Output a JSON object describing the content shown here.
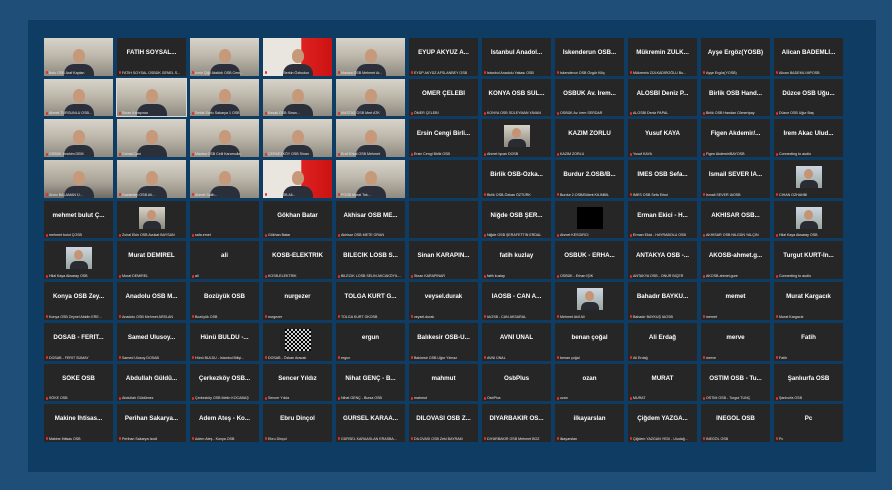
{
  "meeting": {
    "tiles": [
      {
        "kind": "video",
        "name": "",
        "caption": "Bolu OSB Araf Kaplan"
      },
      {
        "kind": "name",
        "name": "FATİH SOYSAL...",
        "caption": "FATİH SOYSAL OSBÜK GENEL S..."
      },
      {
        "kind": "video",
        "name": "",
        "caption": "İzmir Çiğli Atatürk OSB Cem..."
      },
      {
        "kind": "video",
        "variant": "flag",
        "name": "",
        "caption": "MOSTIM Berkin Özbudun"
      },
      {
        "kind": "video",
        "name": "",
        "caption": "Manisa OSB Mehmet Ar..."
      },
      {
        "kind": "name",
        "name": "EYÜP AKYÜZ A...",
        "caption": "EYÜP AKYÜZ AFSLANBEY OSB"
      },
      {
        "kind": "name",
        "name": "İstanbul Anadol...",
        "caption": "İstanbul Anadolu Yakası OSB"
      },
      {
        "kind": "name",
        "name": "İskenderun OSB...",
        "caption": "İskenderun OSB Özgür Kiliç"
      },
      {
        "kind": "name",
        "name": "Mükremin ZÜLK...",
        "caption": "Mükremin ZÜLKADİROĞLU Bu..."
      },
      {
        "kind": "name",
        "name": "Ayşe Ergöz(YOSB)",
        "caption": "Ayşe Ergöz(YOSB)"
      },
      {
        "kind": "name",
        "name": "Alican BADEMLİ...",
        "caption": "Alican BADEMLİ MPOSB"
      },
      {
        "kind": "video",
        "name": "",
        "caption": "Ahmet TURGUNLU OSB..."
      },
      {
        "kind": "video",
        "active": true,
        "name": "",
        "caption": "Sinan Karapınar"
      },
      {
        "kind": "video",
        "name": "",
        "caption": "Sedat Sarkı Sakarya 1 OSB"
      },
      {
        "kind": "video",
        "name": "",
        "caption": "Kavak OSB Sinan..."
      },
      {
        "kind": "video",
        "name": "",
        "caption": "MASTAŞ OSB Mert ATK"
      },
      {
        "kind": "name",
        "name": "ÖMER ÇELEBİ",
        "caption": "ÖMER ÇELEBİ"
      },
      {
        "kind": "name",
        "name": "KONYA OSB SÜL...",
        "caption": "KONYA OSB SÜLEYMAN YAVAN"
      },
      {
        "kind": "name",
        "name": "OSBÜK Av. İrem...",
        "caption": "OSBÜK Av. İrem SERDAR"
      },
      {
        "kind": "name",
        "name": "ALOSBİ Deniz P...",
        "caption": "ALOSBİ Deniz PAPAL"
      },
      {
        "kind": "name",
        "name": "Birlik OSB Hand...",
        "caption": "Birlik OSB Handan Cömertpay"
      },
      {
        "kind": "name",
        "name": "Düzce OSB Uğu...",
        "caption": "Düzce OSB Uğur Baş"
      },
      {
        "kind": "video",
        "name": "",
        "caption": "OSBÜK İbrahim DEM"
      },
      {
        "kind": "video",
        "name": "",
        "caption": "Cemal Cam"
      },
      {
        "kind": "video",
        "name": "",
        "caption": "Manisa OSB Celil Karamolla"
      },
      {
        "kind": "video",
        "name": "",
        "caption": "ÇERKEZKÖY OSB Sinan"
      },
      {
        "kind": "video",
        "name": "",
        "caption": "Ercif Erkal OSB Mehmet"
      },
      {
        "kind": "name",
        "name": "Ersin Cengi Birli...",
        "caption": "Ersin Cengi Birlik OSB"
      },
      {
        "kind": "avatar",
        "name": "",
        "caption": "Ahmet İşcan DOSB"
      },
      {
        "kind": "name",
        "name": "KAZIM ZORLU",
        "caption": "KAZIM ZORLU"
      },
      {
        "kind": "name",
        "name": "Yusuf KAYA",
        "caption": "Yusuf KAYA"
      },
      {
        "kind": "name",
        "name": "Figen Akdemir/...",
        "caption": "Figen Akdemir/BAYOSB"
      },
      {
        "kind": "name",
        "name": "İrem Akac Ulud...",
        "caption": "Connecting to audio"
      },
      {
        "kind": "video",
        "variant": "dark",
        "name": "",
        "caption": "Alsim BALAMAN Ü..."
      },
      {
        "kind": "video",
        "name": "",
        "caption": "Gaziantep OSB Ali..."
      },
      {
        "kind": "video",
        "name": "",
        "caption": "Ahmet Salih..."
      },
      {
        "kind": "video",
        "variant": "flag",
        "name": "",
        "caption": "Mardin OSB Ali..."
      },
      {
        "kind": "video",
        "name": "",
        "caption": "POSB Murat Tok..."
      },
      {
        "kind": "empty",
        "name": "",
        "caption": ""
      },
      {
        "kind": "name",
        "name": "Birlik OSB-Özka...",
        "caption": "Birlik OSB-Özkan ÖZTÜRK"
      },
      {
        "kind": "name",
        "name": "Burdur 2.OSB/B...",
        "caption": "Burdur 2.OSB/Bülent KILINBİL"
      },
      {
        "kind": "name",
        "name": "İMES OSB Sefa...",
        "caption": "İMES OSB Sefa Erkul"
      },
      {
        "kind": "name",
        "name": "İsmail SEVER İA...",
        "caption": "İsmail SEVER İAOSB"
      },
      {
        "kind": "avatar",
        "variant": "photo",
        "name": "",
        "caption": "CİHAN OZHANBİ"
      },
      {
        "kind": "name",
        "name": "mehmet bulut Ç...",
        "caption": "mehmet bulut ÇOSB"
      },
      {
        "kind": "avatar",
        "name": "",
        "caption": "Zuhal Ekin OSB Avukat BAYSAN"
      },
      {
        "kind": "empty",
        "name": "",
        "caption": "safa.emet"
      },
      {
        "kind": "name",
        "name": "Gökhan Batar",
        "caption": "Gökhan Batar"
      },
      {
        "kind": "name",
        "name": "Akhisar OSB ME...",
        "caption": "Akhisar OSB METE ORAN"
      },
      {
        "kind": "empty",
        "name": "",
        "caption": ""
      },
      {
        "kind": "name",
        "name": "Niğde OSB ŞER...",
        "caption": "Niğde OSB ŞERAFETTİN ERDAL"
      },
      {
        "kind": "avatar",
        "variant": "black",
        "name": "",
        "caption": "Ahmet KESGİRCİ"
      },
      {
        "kind": "name",
        "name": "Erman Ekici - H...",
        "caption": "Erman Ekici - HAYRABOLU OSB"
      },
      {
        "kind": "name",
        "name": "AKHİSAR OSB...",
        "caption": "AKHİSAR OSB NİLGÜN YALÇIN"
      },
      {
        "kind": "avatar",
        "variant": "photo",
        "name": "",
        "caption": "Hilal Kaya Aksaray OSB"
      },
      {
        "kind": "avatar",
        "variant": "photo",
        "name": "",
        "caption": "Hilal Kaya Aksaray OSB"
      },
      {
        "kind": "name",
        "name": "Murat DEMİREL",
        "caption": "Murat DEMİREL"
      },
      {
        "kind": "name",
        "name": "ali",
        "caption": "ali"
      },
      {
        "kind": "name",
        "name": "KOSB-ELEKTRİK",
        "caption": "KOSB-ELEKTRİK"
      },
      {
        "kind": "name",
        "name": "BİLECİK LOSB S...",
        "caption": "BİLECİK LOSB SELİN AKCAKÖYİL..."
      },
      {
        "kind": "name",
        "name": "Sinan KARAPIN...",
        "caption": "Sinan KARAPINAR"
      },
      {
        "kind": "name",
        "name": "fatih kuzlay",
        "caption": "fatih kuzlay"
      },
      {
        "kind": "name",
        "name": "OSBÜK - ERHA...",
        "caption": "OSBÜK - Erhan IŞIK"
      },
      {
        "kind": "name",
        "name": "ANTAKYA OSB -...",
        "caption": "ANTAKYA OSB - ONUR BİÇER"
      },
      {
        "kind": "name",
        "name": "AKOSB-ahmet.g...",
        "caption": "AKOSB-ahmet.gure"
      },
      {
        "kind": "name",
        "name": "Turgut KURT-İn...",
        "caption": "Connecting to audio"
      },
      {
        "kind": "name",
        "name": "Konya OSB Zey...",
        "caption": "Konya OSB Zeynel Abidin ERE..."
      },
      {
        "kind": "name",
        "name": "Anadolu OSB M...",
        "caption": "Anadolu OSB Mehmet ARSLAN"
      },
      {
        "kind": "name",
        "name": "Bozüyük OSB",
        "caption": "Bozüyük OSB"
      },
      {
        "kind": "name",
        "name": "nurgezer",
        "caption": "nurgezer"
      },
      {
        "kind": "name",
        "name": "TOLGA KURT G...",
        "caption": "TOLGA KURT GKOSB"
      },
      {
        "kind": "name",
        "name": "veysel.durak",
        "caption": "veysel.durak"
      },
      {
        "kind": "name",
        "name": "İAOSB - CAN A...",
        "caption": "İAOSB - CAN AKSARAL"
      },
      {
        "kind": "avatar",
        "variant": "photo",
        "name": "",
        "caption": "Mehmet Akif Ali"
      },
      {
        "kind": "name",
        "name": "Bahadır BAYKU...",
        "caption": "Bahadır BAYKUŞ İAOSB"
      },
      {
        "kind": "name",
        "name": "memet",
        "caption": "memet"
      },
      {
        "kind": "name",
        "name": "Murat Kargacık",
        "caption": "Murat Kargacık"
      },
      {
        "kind": "name",
        "name": "DOSAB - FERİT...",
        "caption": "DOSAB - FERİT SÜMAY"
      },
      {
        "kind": "name",
        "name": "Samed Ulusoy...",
        "caption": "Samed Ulusoy DOSAB"
      },
      {
        "kind": "name",
        "name": "Hünü BULDU -...",
        "caption": "Hünü BULDU - İstanbul Bilişi..."
      },
      {
        "kind": "avatar",
        "variant": "qr",
        "name": "",
        "caption": "DOSAB - Özkan Aracak"
      },
      {
        "kind": "name",
        "name": "ergun",
        "caption": "ergun"
      },
      {
        "kind": "name",
        "name": "Balıkesir OSB-U...",
        "caption": "Balıkesir OSB Uğur Yılmaz"
      },
      {
        "kind": "name",
        "name": "AVNİ ÜNAL",
        "caption": "AVNİ ÜNAL"
      },
      {
        "kind": "name",
        "name": "benan çoğal",
        "caption": "benan çoğal"
      },
      {
        "kind": "name",
        "name": "Ali Erdağ",
        "caption": "Ali Erdağ"
      },
      {
        "kind": "name",
        "name": "merve",
        "caption": "merve"
      },
      {
        "kind": "name",
        "name": "Fatih",
        "caption": "Fatih"
      },
      {
        "kind": "name",
        "name": "SÖKE OSB",
        "caption": "SÖKE OSB"
      },
      {
        "kind": "name",
        "name": "Abdullah Güldü...",
        "caption": "Abdullah Güldümez"
      },
      {
        "kind": "name",
        "name": "Çerkezköy OSB...",
        "caption": "Çerkezköy OSB Metin KOCABAŞ"
      },
      {
        "kind": "name",
        "name": "Sencer Yıldız",
        "caption": "Sencer Yıldız"
      },
      {
        "kind": "name",
        "name": "Nihat GENÇ - B...",
        "caption": "Nihat GENÇ - Bursa OSB"
      },
      {
        "kind": "name",
        "name": "mahmut",
        "caption": "mahmut"
      },
      {
        "kind": "name",
        "name": "OsbPlus",
        "caption": "OsbPlus"
      },
      {
        "kind": "name",
        "name": "ozan",
        "caption": "ozan"
      },
      {
        "kind": "name",
        "name": "MURAT",
        "caption": "MURAT"
      },
      {
        "kind": "name",
        "name": "OSTİM OSB - Tu...",
        "caption": "OSTİM OSB - Turgut TUNÇ"
      },
      {
        "kind": "name",
        "name": "Şanlıurfa OSB",
        "caption": "Şanlıurfa OSB"
      },
      {
        "kind": "name",
        "name": "Makine İhtisas...",
        "caption": "Makine İhtisas OSB"
      },
      {
        "kind": "name",
        "name": "Perihan Sakarya...",
        "caption": "Perihan Sakarya İzodi"
      },
      {
        "kind": "name",
        "name": "Adem Ateş - Ko...",
        "caption": "Adem Ateş - Konya OSB"
      },
      {
        "kind": "name",
        "name": "Ebru Dinçol",
        "caption": "Ebru Dinçol"
      },
      {
        "kind": "name",
        "name": "GÜRSEL KARAA...",
        "caption": "GÜRSEL KARAASLAN ERASBA..."
      },
      {
        "kind": "name",
        "name": "DİLOVASI OSB Z...",
        "caption": "DİLOVASI OSB Zeki BAYRAM"
      },
      {
        "kind": "name",
        "name": "DİYARBAKIR OS...",
        "caption": "DİYARBAKIR OSB Mehmet BOZ"
      },
      {
        "kind": "name",
        "name": "ilkayarslan",
        "caption": "ilkayarslan"
      },
      {
        "kind": "name",
        "name": "Çiğdem YAZGA...",
        "caption": "Çiğdem YAZGAN YEDİ - Uludağ..."
      },
      {
        "kind": "name",
        "name": "İNEGÖL OSB",
        "caption": "İNEGÖL OSB"
      },
      {
        "kind": "name",
        "name": "Pc",
        "caption": "Pc"
      }
    ]
  }
}
